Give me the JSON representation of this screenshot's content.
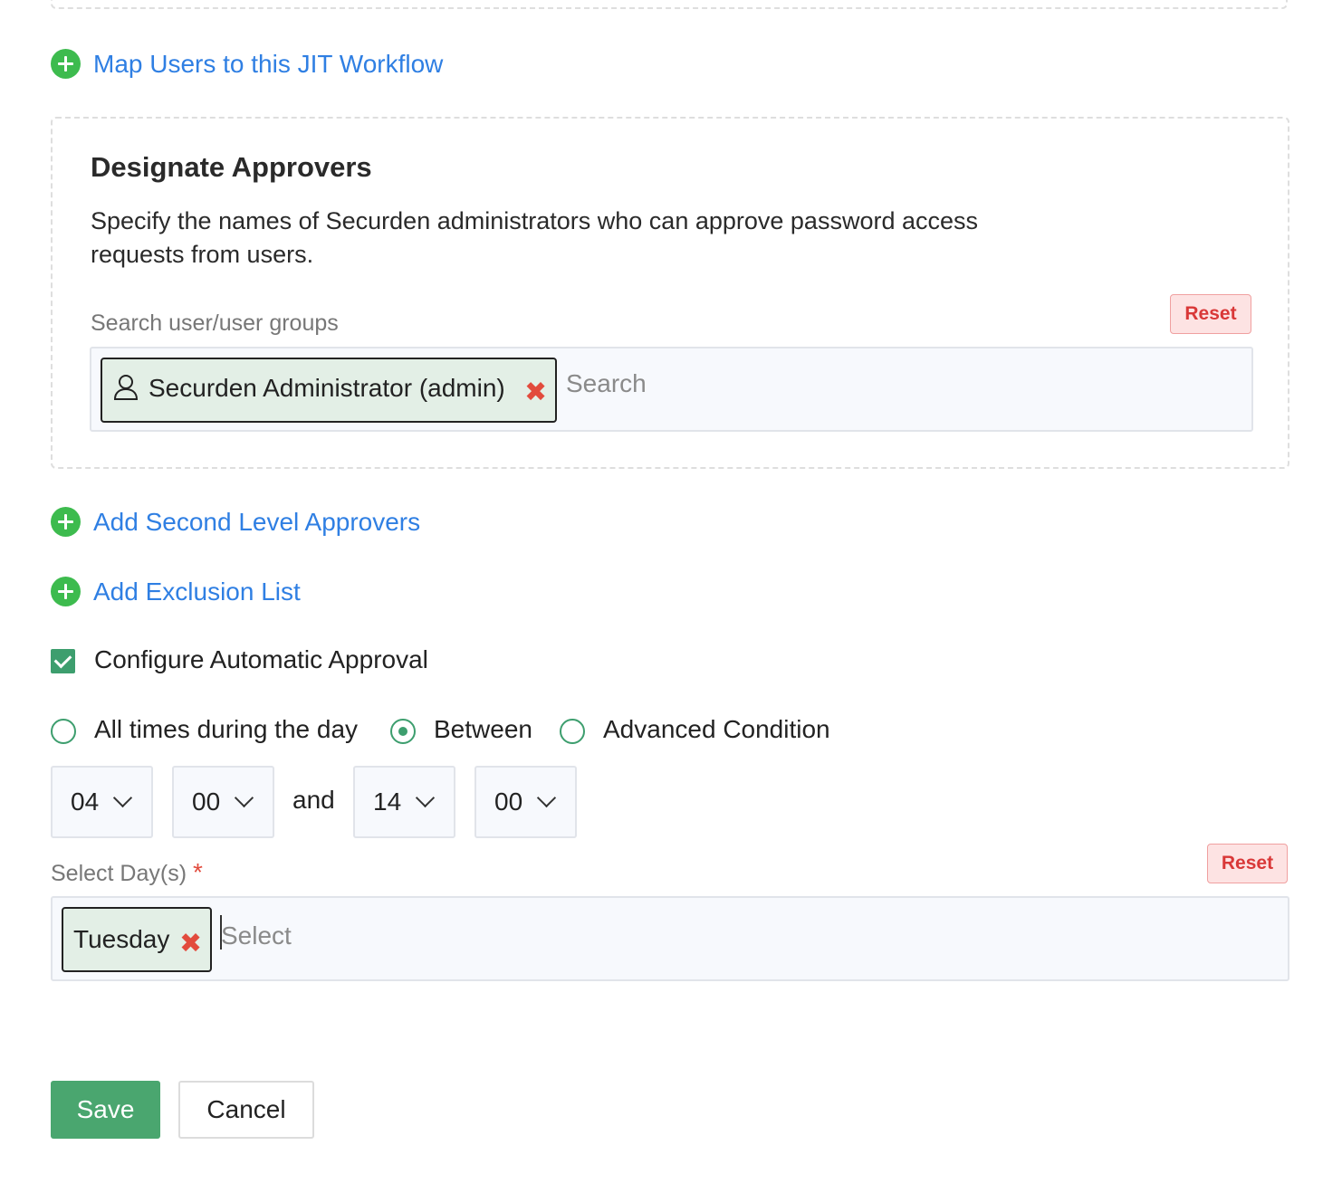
{
  "links": {
    "map_users": "Map Users to this JIT Workflow",
    "second_level": "Add Second Level Approvers",
    "exclusion_list": "Add Exclusion List"
  },
  "approvers": {
    "title": "Designate Approvers",
    "description": "Specify the names of Securden administrators who can approve password access requests from users.",
    "search_label": "Search user/user groups",
    "reset_label": "Reset",
    "selected_user": "Securden Administrator (admin)",
    "search_placeholder": "Search"
  },
  "auto_approval": {
    "checkbox_label": "Configure Automatic Approval",
    "checked": true,
    "options": [
      {
        "label": "All times during the day",
        "selected": false
      },
      {
        "label": "Between",
        "selected": true
      },
      {
        "label": "Advanced Condition",
        "selected": false
      }
    ],
    "start_hour": "04",
    "start_minute": "00",
    "and_label": "and",
    "end_hour": "14",
    "end_minute": "00"
  },
  "days": {
    "label": "Select Day(s)",
    "required_mark": "*",
    "reset_label": "Reset",
    "selected_day": "Tuesday",
    "placeholder": "Select"
  },
  "actions": {
    "save": "Save",
    "cancel": "Cancel"
  },
  "colors": {
    "link": "#2f7fe3",
    "plus": "#3dbb4e",
    "accent": "#3d9e6e",
    "save_bg": "#4aa66f",
    "reset_text": "#d93838",
    "remove": "#e24b3d"
  }
}
